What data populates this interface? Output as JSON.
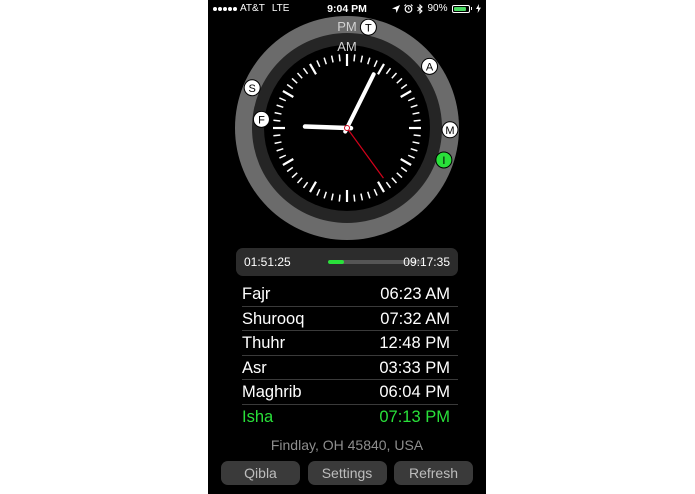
{
  "status_bar": {
    "carrier": "AT&T",
    "network": "LTE",
    "time": "9:04 PM",
    "battery_percent_label": "90%",
    "battery_level": 0.9,
    "icons": [
      "location-arrow-icon",
      "alarm-icon",
      "bluetooth-icon",
      "battery-icon",
      "charging-bolt-icon"
    ]
  },
  "clock": {
    "pm_label": "PM",
    "am_label": "AM",
    "hour": 9,
    "minute": 4,
    "second": 24,
    "markers": [
      {
        "letter": "T",
        "time": "12:48 PM",
        "style": "white"
      },
      {
        "letter": "A",
        "time": "3:33 PM",
        "style": "white"
      },
      {
        "letter": "M",
        "time": "6:04 PM",
        "style": "white"
      },
      {
        "letter": "I",
        "time": "7:13 PM",
        "style": "green"
      },
      {
        "letter": "S",
        "time": "7:32 AM",
        "style": "white"
      },
      {
        "letter": "F",
        "time": "6:23 AM",
        "style": "white"
      }
    ]
  },
  "progress": {
    "elapsed": "01:51:25",
    "remaining": "09:17:35",
    "fraction": 0.17
  },
  "prayers": [
    {
      "name": "Fajr",
      "time": "06:23 AM",
      "active": false
    },
    {
      "name": "Shurooq",
      "time": "07:32 AM",
      "active": false
    },
    {
      "name": "Thuhr",
      "time": "12:48 PM",
      "active": false
    },
    {
      "name": "Asr",
      "time": "03:33 PM",
      "active": false
    },
    {
      "name": "Maghrib",
      "time": "06:04 PM",
      "active": false
    },
    {
      "name": "Isha",
      "time": "07:13 PM",
      "active": true
    }
  ],
  "location": "Findlay, OH 45840, USA",
  "buttons": {
    "qibla": "Qibla",
    "settings": "Settings",
    "refresh": "Refresh"
  },
  "colors": {
    "background": "#000000",
    "accent_green": "#29e03a",
    "outer_ring": "#6b6b6b",
    "second_hand": "#d0021b"
  }
}
